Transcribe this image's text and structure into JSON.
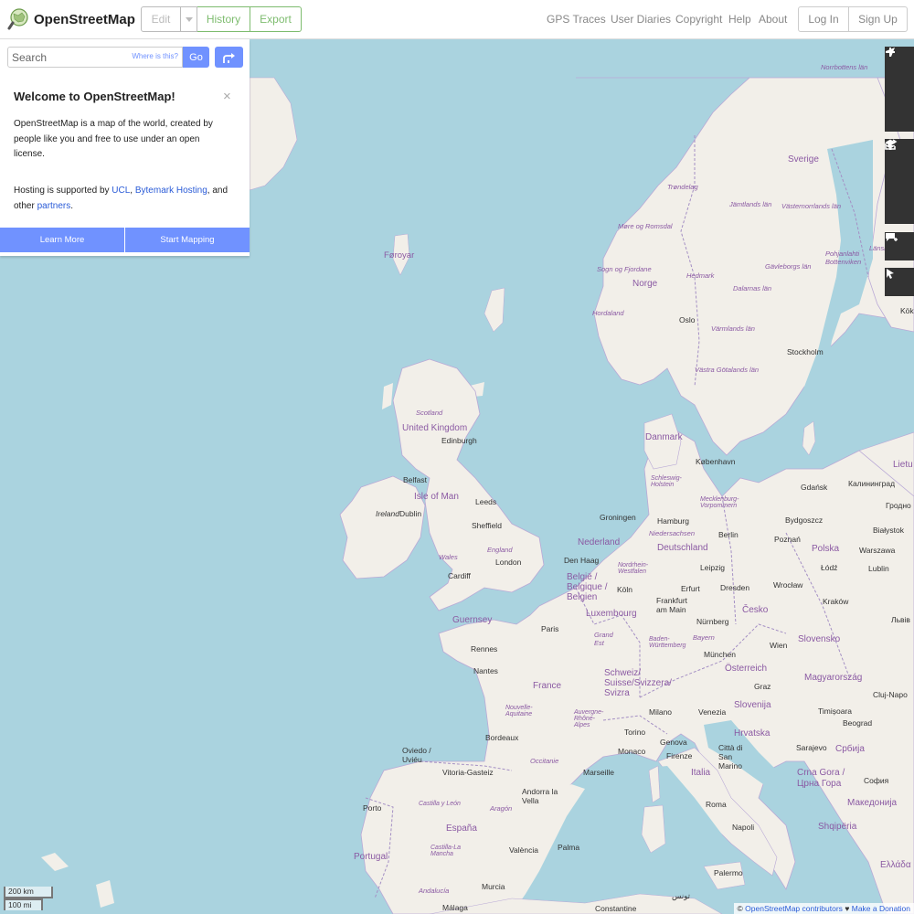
{
  "header": {
    "brand": "OpenStreetMap",
    "edit_label": "Edit",
    "history_label": "History",
    "export_label": "Export",
    "nav": [
      "GPS Traces",
      "User Diaries",
      "Copyright",
      "Help",
      "About"
    ],
    "login_label": "Log In",
    "signup_label": "Sign Up"
  },
  "search": {
    "placeholder": "Search",
    "where_label": "Where is this?",
    "go_label": "Go"
  },
  "welcome": {
    "title": "Welcome to OpenStreetMap!",
    "close": "×",
    "intro": "OpenStreetMap is a map of the world, created by people like you and free to use under an open license.",
    "hosting_prefix": "Hosting is supported by ",
    "hosting_ucl": "UCL",
    "hosting_sep": ", ",
    "hosting_bytemark": "Bytemark Hosting",
    "hosting_mid": ", and other ",
    "hosting_partners": "partners",
    "hosting_end": ".",
    "learn_more": "Learn More",
    "start_mapping": "Start Mapping"
  },
  "map": {
    "controls": [
      "zoom-in",
      "zoom-out",
      "locate",
      "layers",
      "info",
      "share",
      "note",
      "query"
    ],
    "labels": [
      {
        "text": "Norrbottens län"
      },
      {
        "text": "Sverige"
      },
      {
        "text": "Trøndelag"
      },
      {
        "text": "Jämtlands län"
      },
      {
        "text": "Västernorrlands län"
      },
      {
        "text": "Møre og Romsdal"
      },
      {
        "text": "Føroyar"
      },
      {
        "text": "Sogn og Fjordane"
      },
      {
        "text": "Norge"
      },
      {
        "text": "Hedmark"
      },
      {
        "text": "Gävleborgs län"
      },
      {
        "text": "Dalarnas län"
      },
      {
        "text": "Hordaland"
      },
      {
        "text": "Oslo"
      },
      {
        "text": "Värmlands län"
      },
      {
        "text": "Stockholm"
      },
      {
        "text": "Västra Götalands län"
      },
      {
        "text": "Scotland"
      },
      {
        "text": "United Kingdom"
      },
      {
        "text": "Edinburgh"
      },
      {
        "text": "Danmark"
      },
      {
        "text": "København"
      },
      {
        "text": "Belfast"
      },
      {
        "text": "Isle of Man"
      },
      {
        "text": "Leeds"
      },
      {
        "text": "Ireland"
      },
      {
        "text": "Dublin"
      },
      {
        "text": "Sheffield"
      },
      {
        "text": "Schleswig-Holstein"
      },
      {
        "text": "Mecklenburg-Vorpommern"
      },
      {
        "text": "Gdańsk"
      },
      {
        "text": "Калининград"
      },
      {
        "text": "Groningen"
      },
      {
        "text": "Hamburg"
      },
      {
        "text": "Niedersachsen"
      },
      {
        "text": "Berlin"
      },
      {
        "text": "Bydgoszcz"
      },
      {
        "text": "Białystok"
      },
      {
        "text": "England"
      },
      {
        "text": "Wales"
      },
      {
        "text": "London"
      },
      {
        "text": "Cardiff"
      },
      {
        "text": "Nederland"
      },
      {
        "text": "Deutschland"
      },
      {
        "text": "Poznań"
      },
      {
        "text": "Polska"
      },
      {
        "text": "Warszawa"
      },
      {
        "text": "Den Haag"
      },
      {
        "text": "Nordrhein-Westfalen"
      },
      {
        "text": "Leipzig"
      },
      {
        "text": "Łódź"
      },
      {
        "text": "Lublin"
      },
      {
        "text": "België / Belgique / Belgien"
      },
      {
        "text": "Köln"
      },
      {
        "text": "Erfurt"
      },
      {
        "text": "Dresden"
      },
      {
        "text": "Wrocław"
      },
      {
        "text": "Frankfurt am Main"
      },
      {
        "text": "Česko"
      },
      {
        "text": "Kraków"
      },
      {
        "text": "Guernsey"
      },
      {
        "text": "Luxembourg"
      },
      {
        "text": "Nürnberg"
      },
      {
        "text": "Paris"
      },
      {
        "text": "Grand Est"
      },
      {
        "text": "Bayern"
      },
      {
        "text": "Rennes"
      },
      {
        "text": "Baden-Württemberg"
      },
      {
        "text": "Wien"
      },
      {
        "text": "Slovensko"
      },
      {
        "text": "München"
      },
      {
        "text": "Nantes"
      },
      {
        "text": "Österreich"
      },
      {
        "text": "Schweiz/ Suisse/Svizzera/ Svizra"
      },
      {
        "text": "France"
      },
      {
        "text": "Magyarország"
      },
      {
        "text": "Graz"
      },
      {
        "text": "Nouvelle-Aquitaine"
      },
      {
        "text": "Auvergne-Rhône-Alpes"
      },
      {
        "text": "Milano"
      },
      {
        "text": "Venezia"
      },
      {
        "text": "Slovenija"
      },
      {
        "text": "Timișoara"
      },
      {
        "text": "Bordeaux"
      },
      {
        "text": "Torino"
      },
      {
        "text": "Hrvatska"
      },
      {
        "text": "Beograd"
      },
      {
        "text": "Oviedo / Uviéu"
      },
      {
        "text": "Genova"
      },
      {
        "text": "Sarajevo"
      },
      {
        "text": "Србија"
      },
      {
        "text": "Monaco"
      },
      {
        "text": "Firenze"
      },
      {
        "text": "Città di San Marino"
      },
      {
        "text": "Occitanie"
      },
      {
        "text": "Vitoria-Gasteiz"
      },
      {
        "text": "Marseille"
      },
      {
        "text": "Italia"
      },
      {
        "text": "Crna Gora / Црна Гора"
      },
      {
        "text": "София"
      },
      {
        "text": "Andorra la Vella"
      },
      {
        "text": "Porto"
      },
      {
        "text": "Castilla y León"
      },
      {
        "text": "Aragón"
      },
      {
        "text": "Roma"
      },
      {
        "text": "Македонија"
      },
      {
        "text": "España"
      },
      {
        "text": "Napoli"
      },
      {
        "text": "Shqipëria"
      },
      {
        "text": "Portugal"
      },
      {
        "text": "Castilla-La Mancha"
      },
      {
        "text": "València"
      },
      {
        "text": "Palma"
      },
      {
        "text": "Ελλάδα"
      },
      {
        "text": "Palermo"
      },
      {
        "text": "Andalucía"
      },
      {
        "text": "Murcia"
      },
      {
        "text": "Málaga"
      },
      {
        "text": "Constantine"
      },
      {
        "text": "تونس"
      },
      {
        "text": "Lietu"
      },
      {
        "text": "Гродно"
      },
      {
        "text": "Львів"
      },
      {
        "text": "Cluj-Napo"
      },
      {
        "text": "Pohjanlahti Bottenviken"
      },
      {
        "text": "Länsi-Suo"
      },
      {
        "text": "Kök"
      }
    ],
    "scale": {
      "metric": "200 km",
      "imperial": "100 mi"
    },
    "attribution": {
      "copy": "©",
      "osm": "OpenStreetMap contributors",
      "heart": "♥",
      "donate": "Make a Donation"
    }
  },
  "colors": {
    "accent": "#7092ff",
    "edit_green": "#7ebc6f",
    "water": "#aad3df",
    "land": "#f2efe9",
    "border": "#a48fc4"
  }
}
